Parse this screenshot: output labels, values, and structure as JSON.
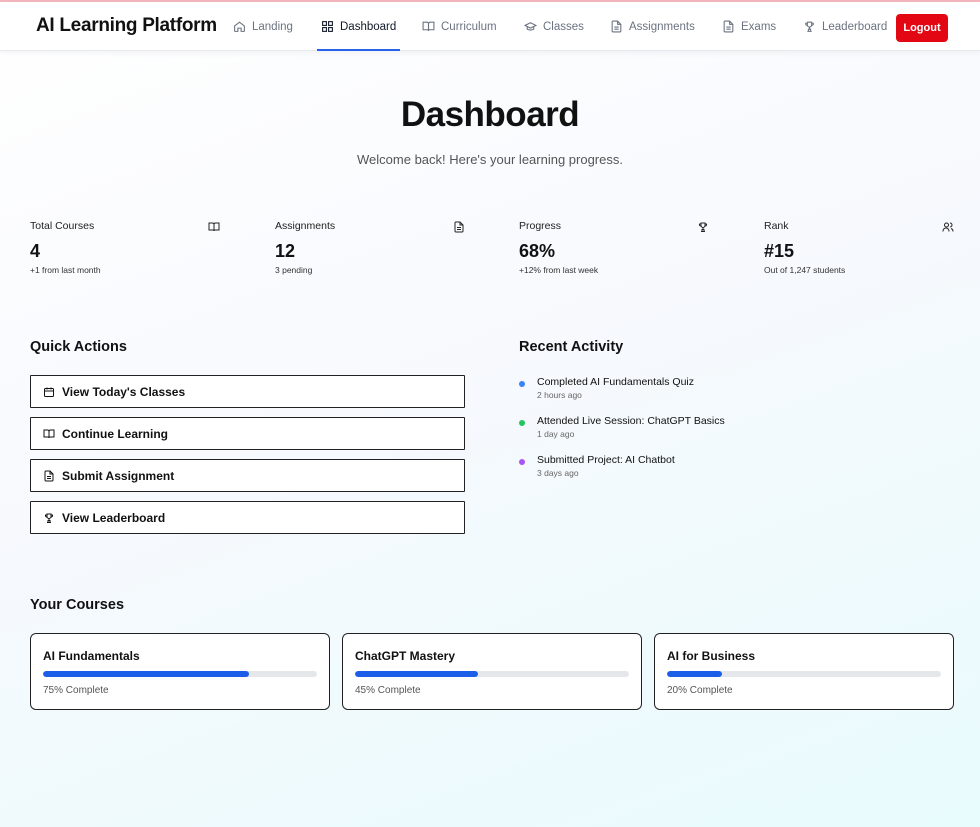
{
  "nav": {
    "brand": "AI Learning Platform",
    "items": [
      {
        "label": "Landing",
        "icon": "home-icon"
      },
      {
        "label": "Dashboard",
        "icon": "dashboard-icon"
      },
      {
        "label": "Curriculum",
        "icon": "book-icon"
      },
      {
        "label": "Classes",
        "icon": "graduation-cap-icon"
      },
      {
        "label": "Assignments",
        "icon": "file-icon"
      },
      {
        "label": "Exams",
        "icon": "file-icon"
      },
      {
        "label": "Leaderboard",
        "icon": "trophy-icon"
      }
    ],
    "active": "Dashboard",
    "logout_label": "Logout"
  },
  "header": {
    "title": "Dashboard",
    "subtitle": "Welcome back! Here's your learning progress."
  },
  "stats": [
    {
      "label": "Total Courses",
      "value": "4",
      "note": "+1 from last month",
      "icon": "book-icon"
    },
    {
      "label": "Assignments",
      "value": "12",
      "note": "3 pending",
      "icon": "file-icon"
    },
    {
      "label": "Progress",
      "value": "68%",
      "note": "+12% from last week",
      "icon": "trophy-icon"
    },
    {
      "label": "Rank",
      "value": "#15",
      "note": "Out of 1,247 students",
      "icon": "users-icon"
    }
  ],
  "quick_actions": {
    "title": "Quick Actions",
    "items": [
      {
        "label": "View Today's Classes",
        "icon": "calendar-icon"
      },
      {
        "label": "Continue Learning",
        "icon": "book-icon"
      },
      {
        "label": "Submit Assignment",
        "icon": "file-icon"
      },
      {
        "label": "View Leaderboard",
        "icon": "trophy-icon"
      }
    ]
  },
  "activity": {
    "title": "Recent Activity",
    "items": [
      {
        "title": "Completed AI Fundamentals Quiz",
        "time": "2 hours ago",
        "color": "#3b82f6"
      },
      {
        "title": "Attended Live Session: ChatGPT Basics",
        "time": "1 day ago",
        "color": "#22c55e"
      },
      {
        "title": "Submitted Project: AI Chatbot",
        "time": "3 days ago",
        "color": "#a855f7"
      }
    ]
  },
  "courses": {
    "title": "Your Courses",
    "items": [
      {
        "name": "AI Fundamentals",
        "progress": 0.75,
        "progress_label": "75% Complete"
      },
      {
        "name": "ChatGPT Mastery",
        "progress": 0.45,
        "progress_label": "45% Complete"
      },
      {
        "name": "AI for Business",
        "progress": 0.2,
        "progress_label": "20% Complete"
      }
    ]
  },
  "colors": {
    "accent": "#2563eb",
    "progress_fill": "#1d5ee8",
    "logout": "#e30613"
  }
}
